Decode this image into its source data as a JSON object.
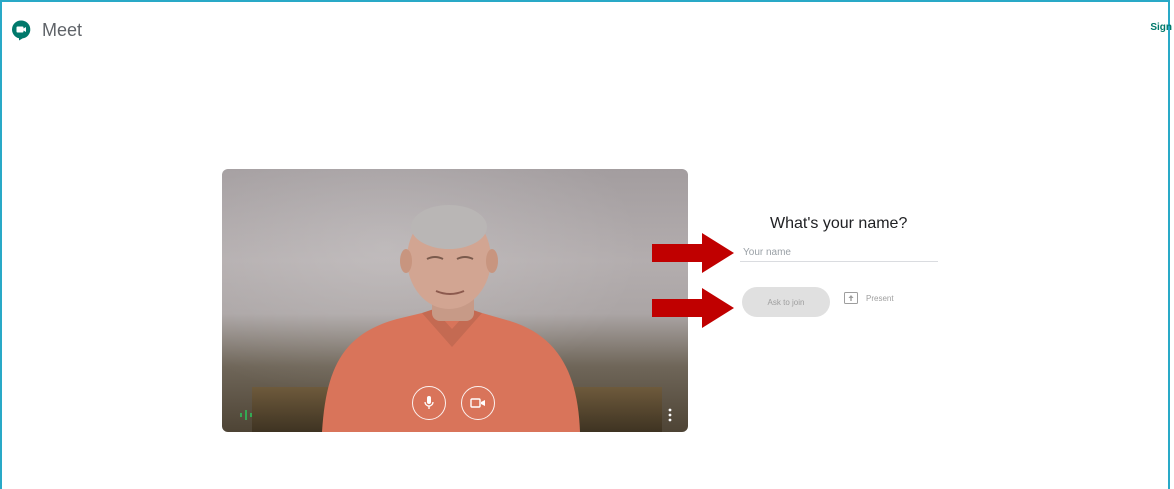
{
  "app": {
    "title": "Meet",
    "sign_in_label": "Sign"
  },
  "join": {
    "question": "What's your name?",
    "name_placeholder": "Your name",
    "name_value": "",
    "ask_to_join_label": "Ask to join",
    "present_label": "Present"
  },
  "video_controls": {
    "mic_icon": "microphone-icon",
    "camera_icon": "video-camera-icon",
    "more_icon": "more-vertical-icon",
    "audio_level_icon": "audio-level-icon"
  },
  "colors": {
    "frame_border": "#29a9c7",
    "brand_green": "#00796b",
    "annotation_arrow": "#c00000",
    "disabled_button_bg": "#e0e0e0"
  }
}
